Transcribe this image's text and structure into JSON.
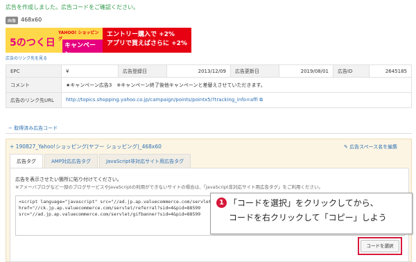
{
  "flash_message": "広告を作成しました。広告コードをご確認ください。",
  "ad_type_badge": "画像",
  "ad_size": "468x60",
  "banner": {
    "big_text": "5のつく日",
    "yahoo_brand": "YAHOO! ショッピング",
    "campaign_label": "キャンペーン",
    "right_line1": "エントリー購入で +2%",
    "right_line2": "アプリで買えばさらに +2%"
  },
  "link_check_label": "広告のリンク先を見る",
  "info_table": {
    "epc_label": "EPC",
    "epc_value": "¥",
    "registered_label": "広告登録日",
    "registered_value": "2013/12/09",
    "updated_label": "広告更新日",
    "updated_value": "2019/08/01",
    "ad_id_label": "広告ID",
    "ad_id_value": "2645185",
    "comment_label": "コメント",
    "comment_value": "★キャンペーン広告3　※キャンペーン終了後他キャンペーンと差替えさせていただきます。",
    "url_label": "広告のリンク先URL",
    "url_value": "http://topics.shopping.yahoo.co.jp/campaign/points/pointx5/?tracking_info=affi"
  },
  "section_title": "− 取得済み広告コード",
  "panel": {
    "title": "+ 190827_Yahoo!ショッピング(ヤフー ショッピング)_468x60",
    "edit_link": "広告スペース名を編集"
  },
  "tabs": [
    {
      "label": "広告タグ"
    },
    {
      "label": "AMP対応広告タグ"
    },
    {
      "label": "JavaScript非対応サイト用広告タグ"
    }
  ],
  "instruction": "広告を表示させたい箇所に貼り付けてください。",
  "note": "※アメーバブログなど一部のブログサービスやJavaScriptの利用ができないサイトの場合は、「JavaScript非対応サイト用広告タグ」をご利用ください。",
  "code_lines": [
    "<script language=\"javascript\" src=\"//ad.jp.ap.valuecommerce.com/servlet/",
    "href=\"//ck.jp.ap.valuecommerce.com/servlet/referral?sid=4&pid=88599",
    "src=\"//ad.jp.ap.valuecommerce.com/servlet/gifbanner?sid=4&pid=88599"
  ],
  "callout": {
    "number": "1",
    "line1": "「コードを選択」をクリックしてから、",
    "line2": "コードを右クリックして「コピー」しよう"
  },
  "select_button_label": "コードを選択",
  "colors": {
    "link": "#2b6fb3",
    "success": "#2f9a4a",
    "accent_red": "#d6183a",
    "panel_bg": "#fdf5e3"
  }
}
